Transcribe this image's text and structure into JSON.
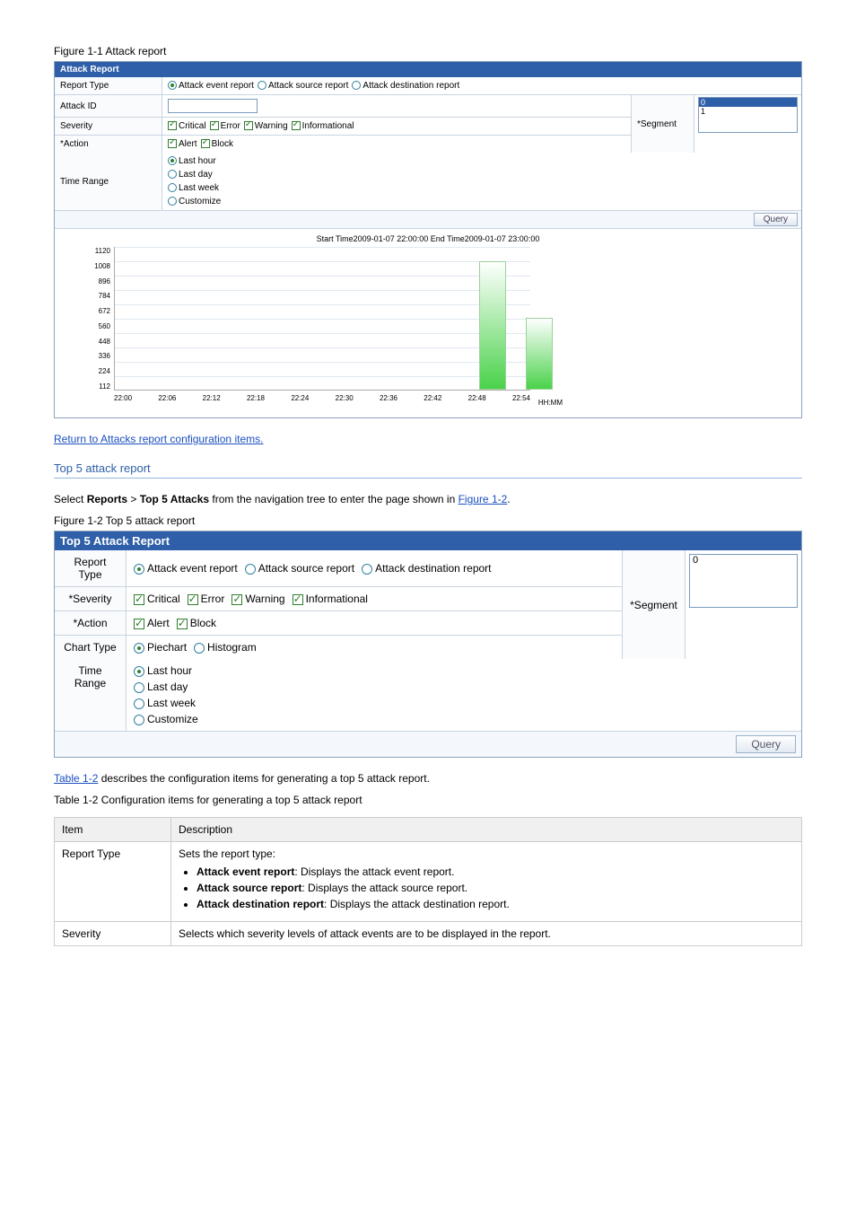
{
  "fig1": {
    "caption": "Figure 1-1 Attack report",
    "header": "Attack Report",
    "rows": {
      "report_type_label": "Report Type",
      "radios": [
        "Attack event report",
        "Attack source report",
        "Attack destination report"
      ],
      "attack_id_label": "Attack ID",
      "severity_label": "Severity",
      "severity_opts": [
        "Critical",
        "Error",
        "Warning",
        "Informational"
      ],
      "action_label": "*Action",
      "action_opts": [
        "Alert",
        "Block"
      ],
      "time_range_label": "Time Range",
      "time_opts": [
        "Last hour",
        "Last day",
        "Last week",
        "Customize"
      ],
      "segment_label": "*Segment",
      "segment_items": [
        "0",
        "1"
      ]
    },
    "query": "Query",
    "chart_title": "Start Time2009-01-07 22:00:00 End Time2009-01-07 23:00:00"
  },
  "chart_data": {
    "type": "bar",
    "title": "Start Time2009-01-07 22:00:00 End Time2009-01-07 23:00:00",
    "x_ticks": [
      "22:00",
      "22:06",
      "22:12",
      "22:18",
      "22:24",
      "22:30",
      "22:36",
      "22:42",
      "22:48",
      "22:54"
    ],
    "x_unit": "HH:MM",
    "y_ticks": [
      112,
      224,
      336,
      448,
      560,
      672,
      784,
      896,
      1008,
      1120
    ],
    "ylim": [
      0,
      1120
    ],
    "bars": [
      {
        "x": "22:48",
        "value": 1000
      },
      {
        "x": "22:54",
        "value": 560
      }
    ]
  },
  "step1": "Return to Attacks report configuration items.",
  "top5": {
    "heading": "Top 5 attack report",
    "intro_prefix": "Select ",
    "intro_bold1": "Reports",
    "intro_mid": " > ",
    "intro_bold2": "Top 5 Attacks",
    "intro_suffix": " from the navigation tree to enter the page shown in ",
    "intro_link": "Figure 1-2",
    "caption": "Figure 1-2 Top 5 attack report",
    "header": "Top 5 Attack Report",
    "report_type_label": "Report Type",
    "radios": [
      "Attack event report",
      "Attack source report",
      "Attack destination report"
    ],
    "severity_label": "*Severity",
    "severity_opts": [
      "Critical",
      "Error",
      "Warning",
      "Informational"
    ],
    "action_label": "*Action",
    "action_opts": [
      "Alert",
      "Block"
    ],
    "chart_type_label": "Chart Type",
    "chart_type_opts": [
      "Piechart",
      "Histogram"
    ],
    "time_range_label": "Time Range",
    "time_opts": [
      "Last hour",
      "Last day",
      "Last week",
      "Customize"
    ],
    "segment_label": "*Segment",
    "segment_items": [
      "0"
    ],
    "query": "Query"
  },
  "table2_link": "Table 1-2",
  "table2_after": " describes the configuration items for generating a top 5 attack report.",
  "table2_caption": "Table 1-2 Configuration items for generating a top 5 attack report",
  "desc_table": {
    "head": [
      "Item",
      "Description"
    ],
    "row1": {
      "item": "Report Type",
      "desc_intro": "Sets the report type:",
      "b1_label": "Attack event report",
      "b1_text": ": Displays the attack event report.",
      "b2_label": "Attack source report",
      "b2_text": ": Displays the attack source report.",
      "b3_label": "Attack destination report",
      "b3_text": ": Displays the attack destination report."
    },
    "row2": {
      "item": "Severity",
      "text": "Selects which severity levels of attack events are to be displayed in the report."
    }
  }
}
